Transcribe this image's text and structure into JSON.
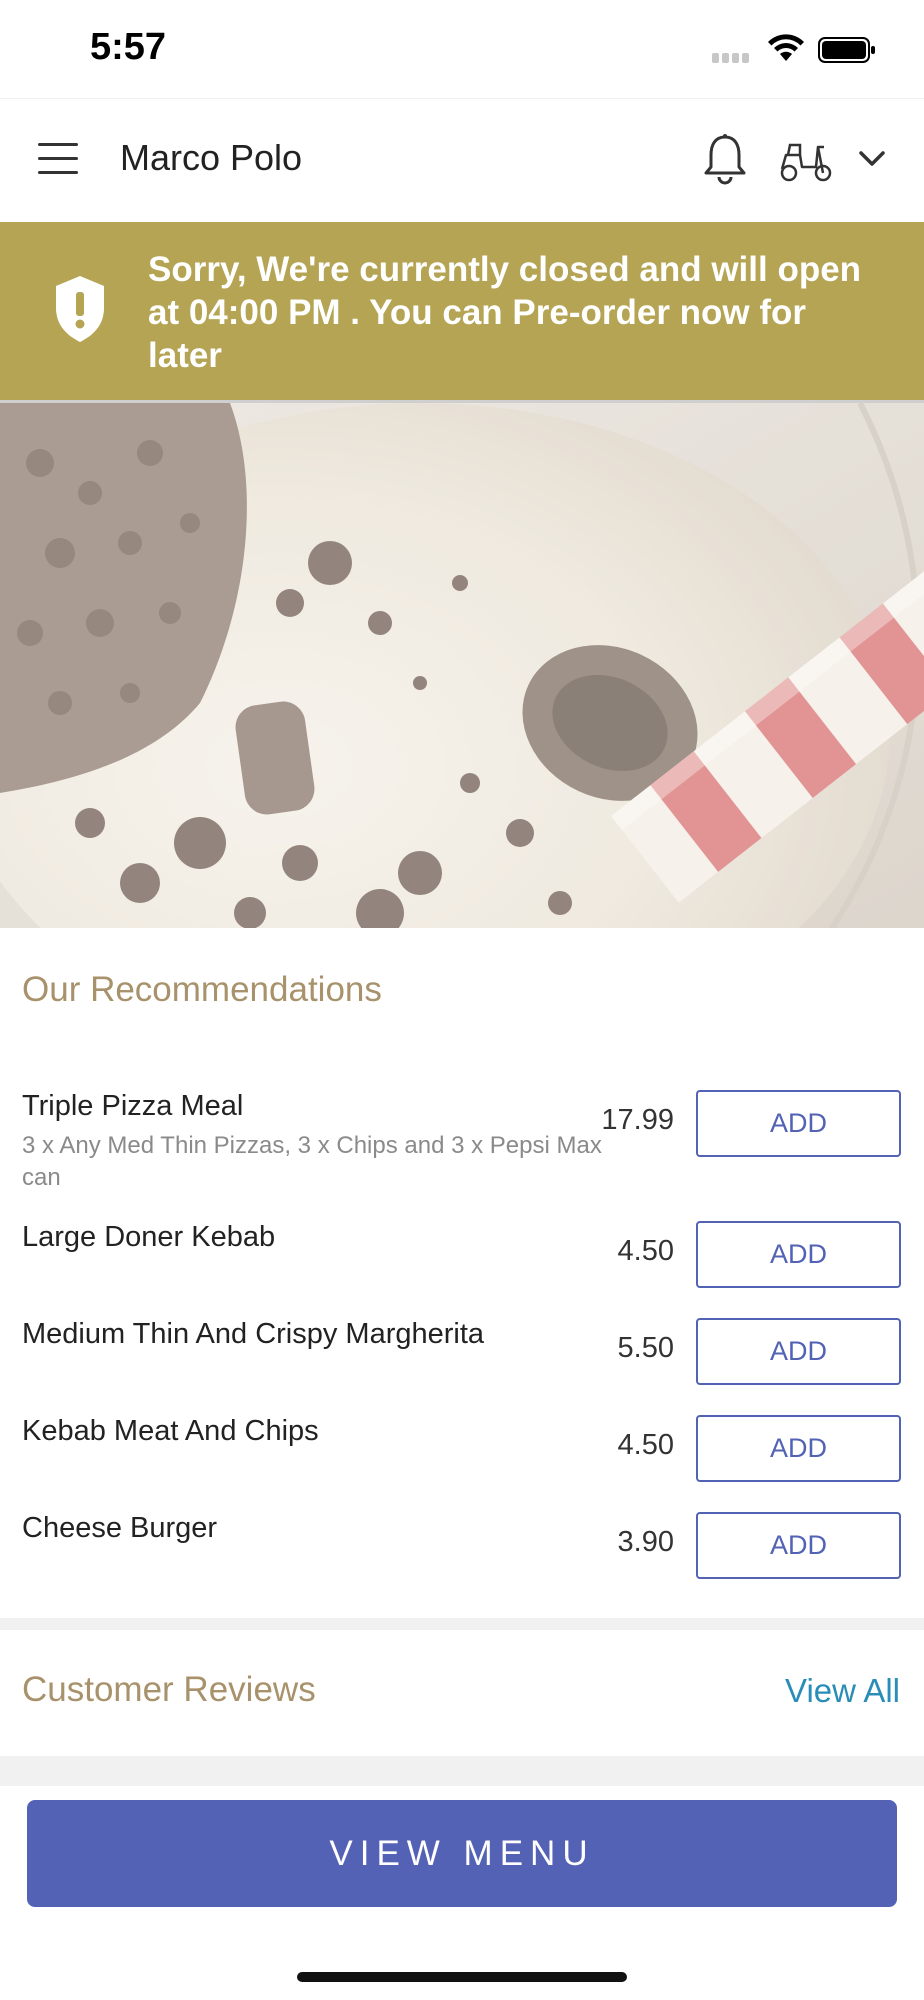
{
  "status_bar": {
    "time": "5:57"
  },
  "header": {
    "title": "Marco Polo"
  },
  "banner": {
    "message": "Sorry, We're currently closed and will open at 04:00 PM . You can Pre-order now for later"
  },
  "recommendations": {
    "title": "Our Recommendations",
    "items": [
      {
        "name": "Triple Pizza Meal",
        "description": "3 x Any Med Thin Pizzas, 3 x Chips and 3 x Pepsi Max can",
        "price": "17.99",
        "button": "ADD"
      },
      {
        "name": "Large Doner Kebab",
        "description": "",
        "price": "4.50",
        "button": "ADD"
      },
      {
        "name": "Medium Thin And Crispy Margherita",
        "description": "",
        "price": "5.50",
        "button": "ADD"
      },
      {
        "name": "Kebab Meat And Chips",
        "description": "",
        "price": "4.50",
        "button": "ADD"
      },
      {
        "name": "Cheese Burger",
        "description": "",
        "price": "3.90",
        "button": "ADD"
      }
    ]
  },
  "reviews": {
    "title": "Customer Reviews",
    "view_all": "View All"
  },
  "footer": {
    "view_menu": "VIEW MENU"
  },
  "colors": {
    "banner": "#b4a453",
    "accent": "#5462b5",
    "section_title": "#a8926b",
    "link": "#2a8db8"
  },
  "icons": [
    "hamburger-menu-icon",
    "bell-icon",
    "scooter-icon",
    "chevron-down-icon",
    "shield-alert-icon",
    "wifi-icon",
    "battery-icon",
    "signal-icon"
  ]
}
